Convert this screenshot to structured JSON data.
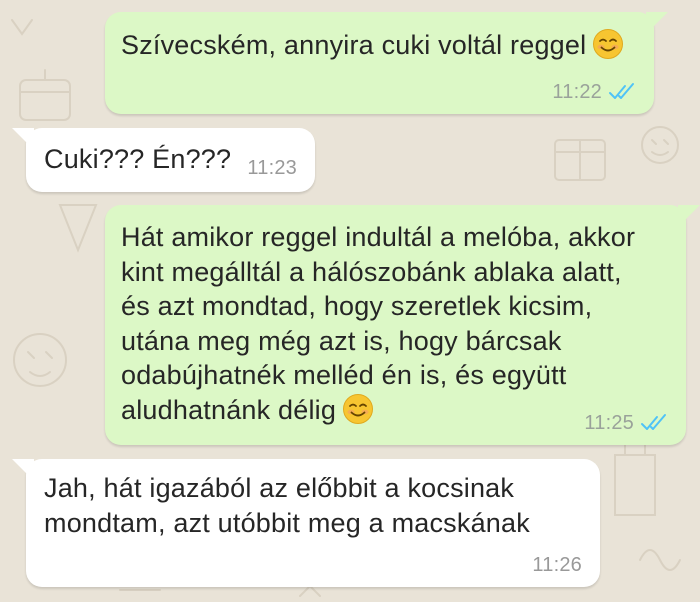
{
  "theme": {
    "chat_background": "#e9e3d7",
    "outgoing_bubble": "#dcf8c6",
    "incoming_bubble": "#ffffff",
    "read_receipt": "#4fc3f7",
    "emoji_face": "#f7c531"
  },
  "messages": [
    {
      "direction": "outgoing",
      "text": "Szívecském, annyira cuki voltál reggel",
      "emoji": "smiling-face",
      "time": "11:22",
      "status": "read"
    },
    {
      "direction": "incoming",
      "text": "Cuki??? Én???",
      "time": "11:23"
    },
    {
      "direction": "outgoing",
      "text": "Hát amikor reggel indultál a melóba, akkor\nkint megálltál a hálószobánk ablaka alatt,\nés azt mondtad, hogy szeretlek kicsim,\nutána meg még azt is, hogy bárcsak\nodabújhatnék melléd én is, és együtt\naludhatnánk délig",
      "emoji": "smiling-face",
      "time": "11:25",
      "status": "read"
    },
    {
      "direction": "incoming",
      "text": "Jah, hát igazából az előbbit a kocsinak\nmondtam, azt utóbbit meg a macskának",
      "time": "11:26"
    }
  ]
}
